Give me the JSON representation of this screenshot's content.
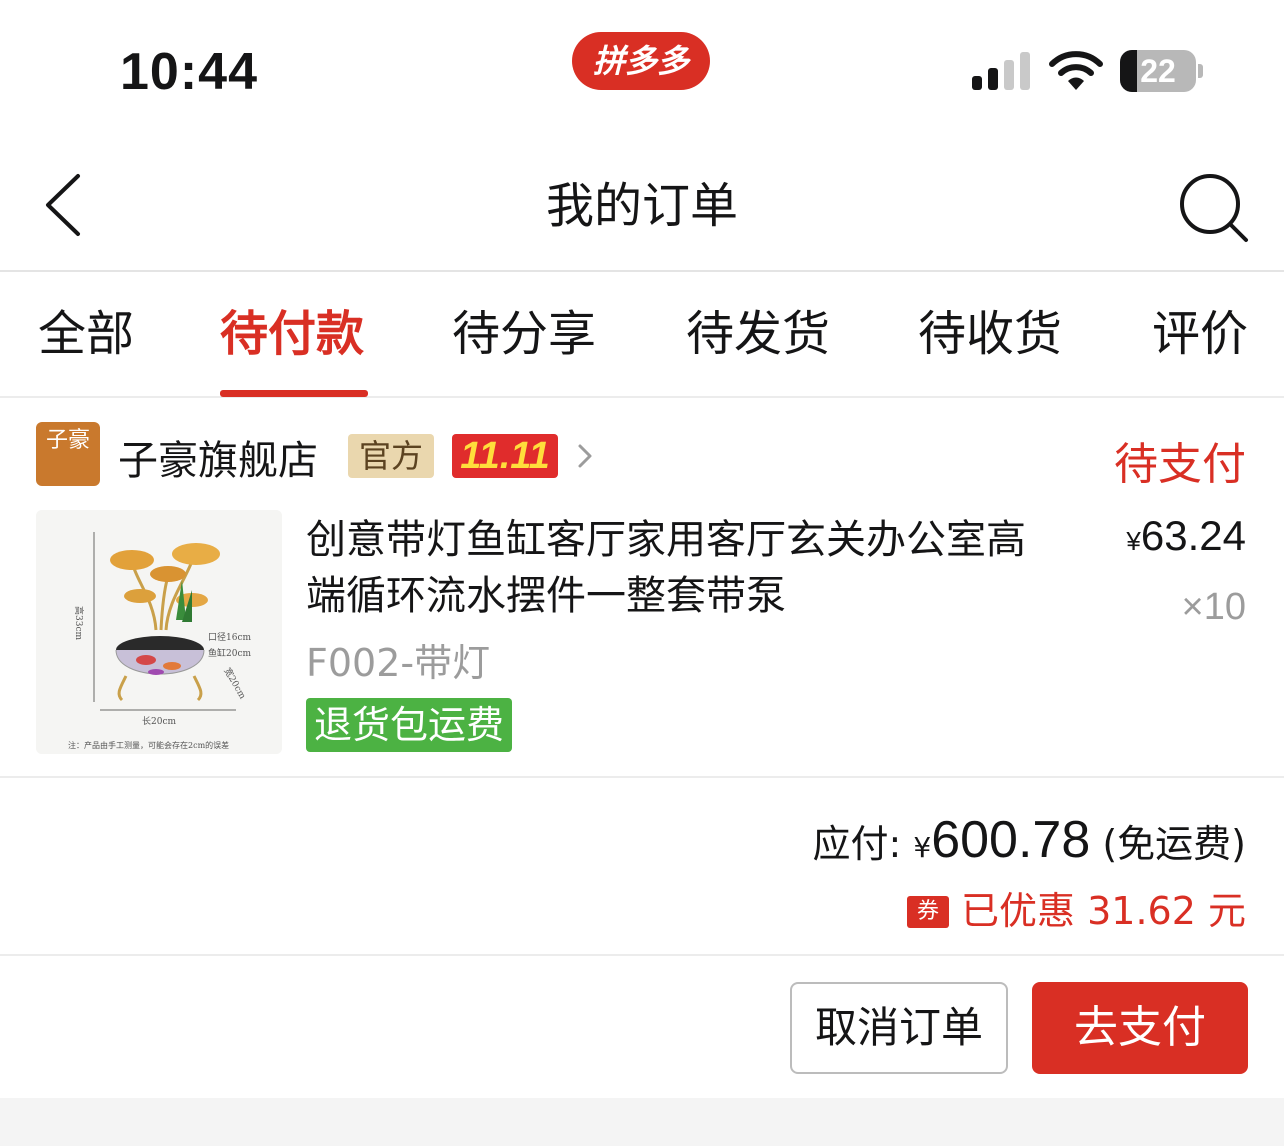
{
  "status_bar": {
    "time": "10:44",
    "app_badge": "拼多多",
    "battery_level": "22",
    "battery_fraction": 0.22,
    "signal_bars_active": 2
  },
  "nav": {
    "title": "我的订单",
    "back_icon": "chevron-left-icon",
    "search_icon": "search-icon"
  },
  "tabs": [
    {
      "label": "全部",
      "active": false
    },
    {
      "label": "待付款",
      "active": true
    },
    {
      "label": "待分享",
      "active": false
    },
    {
      "label": "待发货",
      "active": false
    },
    {
      "label": "待收货",
      "active": false
    },
    {
      "label": "评价",
      "active": false
    }
  ],
  "order": {
    "store": {
      "logo_text": "子豪",
      "name": "子豪旗舰店",
      "official_badge": "官方",
      "promo_badge": "11.11"
    },
    "status": "待支付",
    "product": {
      "title": "创意带灯鱼缸客厅家用客厅玄关办公室高端循环流水摆件一整套带泵",
      "spec": "F002-带灯",
      "return_badge": "退货包运费",
      "currency": "¥",
      "unit_price": "63.24",
      "quantity": "×10",
      "image_labels": {
        "height": "高33cm",
        "caliber": "口径16cm",
        "tank": "鱼缸20cm",
        "width": "宽20cm",
        "length": "长20cm",
        "note": "注：产品由手工测量，可能会存在2cm的误差"
      }
    },
    "total": {
      "label": "应付:",
      "currency": "¥",
      "amount": "600.78",
      "shipping": "(免运费)",
      "coupon_icon": "券",
      "discount_text": "已优惠 31.62 元"
    },
    "actions": {
      "cancel_label": "取消订单",
      "pay_label": "去支付"
    }
  },
  "colors": {
    "accent": "#d92f24",
    "return_green": "#4cb243",
    "official_bg": "#ead7ae",
    "text_primary": "#151516",
    "text_secondary": "#9c9c9c"
  }
}
